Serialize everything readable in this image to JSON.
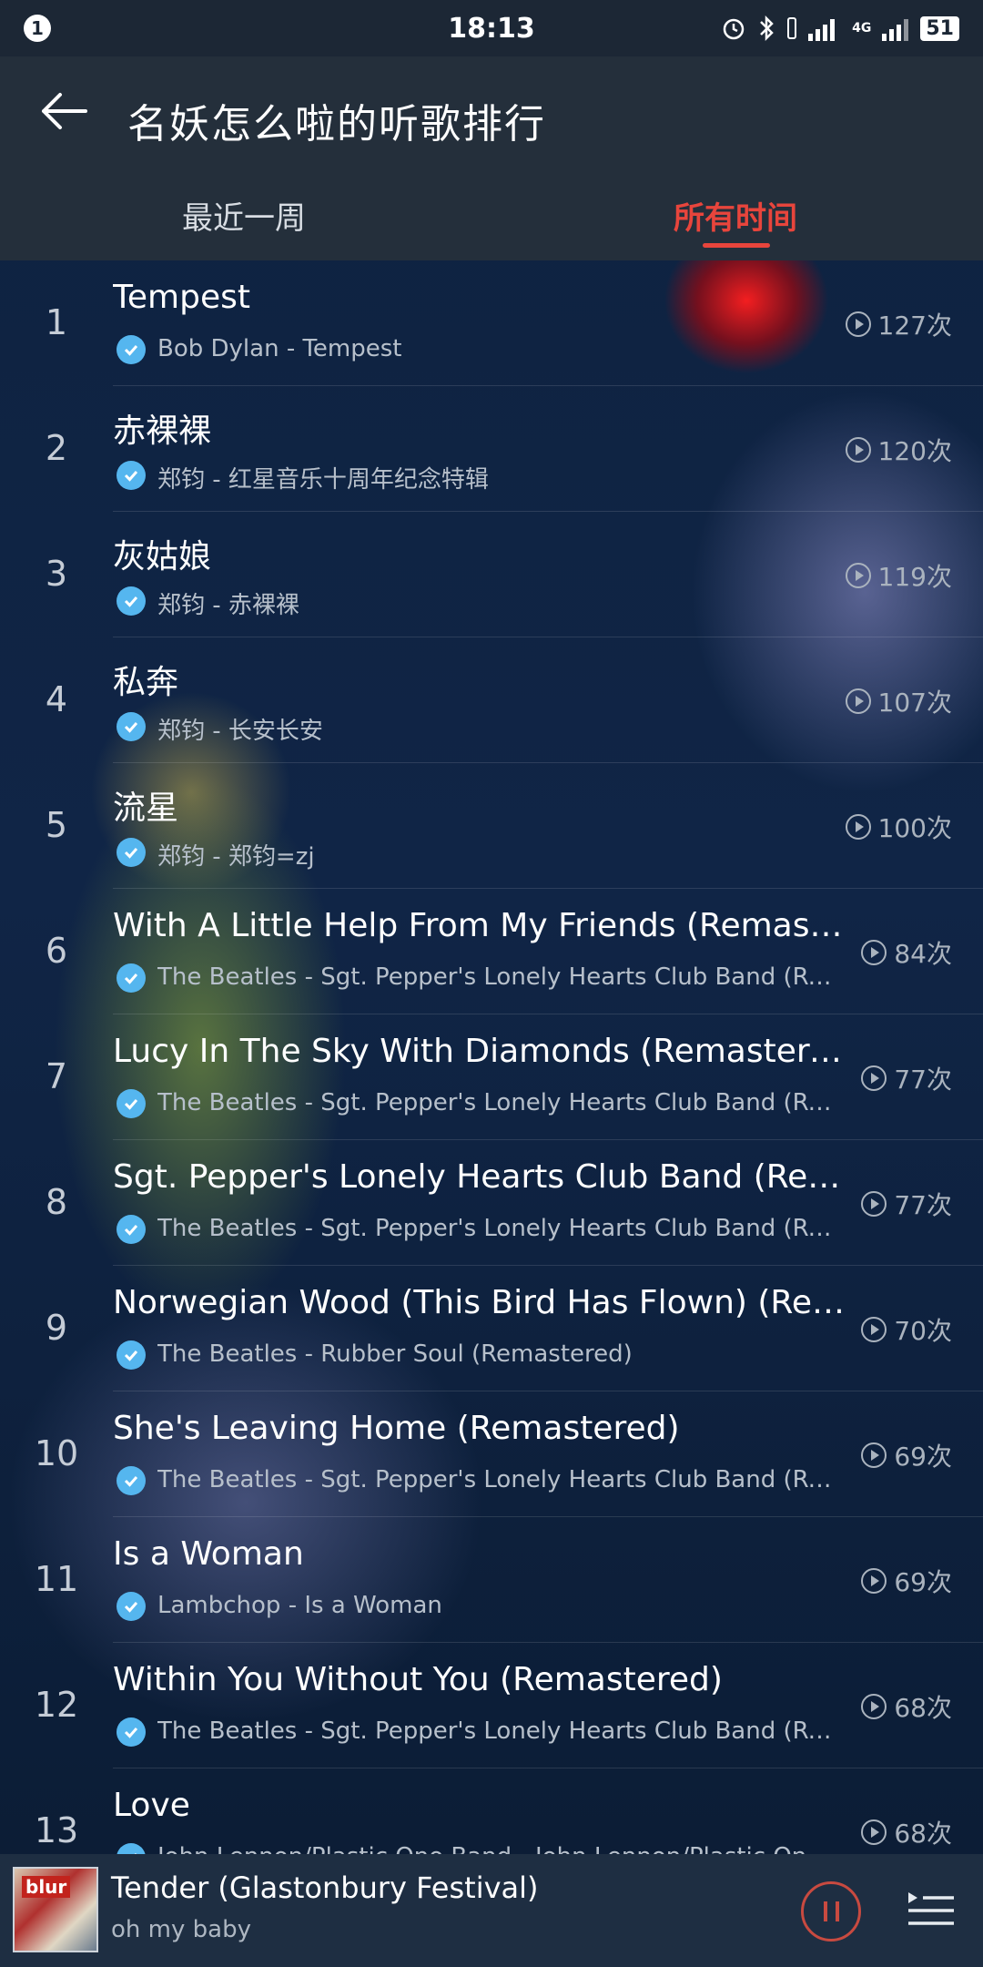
{
  "status": {
    "notification_count": "1",
    "time": "18:13",
    "net_label": "4G",
    "battery": "51"
  },
  "header": {
    "title": "名妖怎么啦的听歌排行",
    "tabs": [
      {
        "label": "最近一周"
      },
      {
        "label": "所有时间"
      }
    ]
  },
  "songs": [
    {
      "rank": "1",
      "title": "Tempest",
      "sub": "Bob Dylan - Tempest",
      "count": "127次"
    },
    {
      "rank": "2",
      "title": "赤裸裸",
      "sub": "郑钧 - 红星音乐十周年纪念特辑",
      "count": "120次"
    },
    {
      "rank": "3",
      "title": "灰姑娘",
      "sub": "郑钧 - 赤裸裸",
      "count": "119次"
    },
    {
      "rank": "4",
      "title": "私奔",
      "sub": "郑钧 - 长安长安",
      "count": "107次"
    },
    {
      "rank": "5",
      "title": "流星",
      "sub": "郑钧 - 郑钧=zj",
      "count": "100次"
    },
    {
      "rank": "6",
      "title": "With A Little Help From My Friends (Remastered)",
      "sub": "The Beatles - Sgt. Pepper's Lonely Hearts Club Band (Rem...",
      "count": "84次"
    },
    {
      "rank": "7",
      "title": "Lucy In The Sky With Diamonds (Remastered)",
      "sub": "The Beatles - Sgt. Pepper's Lonely Hearts Club Band (Rem...",
      "count": "77次"
    },
    {
      "rank": "8",
      "title": "Sgt. Pepper's Lonely Hearts Club Band (Rema...",
      "sub": "The Beatles - Sgt. Pepper's Lonely Hearts Club Band (Rem...",
      "count": "77次"
    },
    {
      "rank": "9",
      "title": "Norwegian Wood (This Bird Has Flown) (Rema...",
      "sub": "The Beatles - Rubber Soul (Remastered)",
      "count": "70次"
    },
    {
      "rank": "10",
      "title": "She's Leaving Home (Remastered)",
      "sub": "The Beatles - Sgt. Pepper's Lonely Hearts Club Band (Rem...",
      "count": "69次"
    },
    {
      "rank": "11",
      "title": "Is a Woman",
      "sub": "Lambchop - Is a Woman",
      "count": "69次"
    },
    {
      "rank": "12",
      "title": "Within You Without You (Remastered)",
      "sub": "The Beatles - Sgt. Pepper's Lonely Hearts Club Band (Rem...",
      "count": "68次"
    },
    {
      "rank": "13",
      "title": "Love",
      "sub": "John Lennon/Plastic Ono Band - John Lennon/Plastic Ono...",
      "count": "68次"
    }
  ],
  "player": {
    "album_logo": "blur",
    "title": "Tender (Glastonbury Festival)",
    "subtitle": "oh my baby"
  },
  "colors": {
    "accent": "#e8453c",
    "verified": "#55b6ef",
    "header_bg": "#242f3b",
    "player_bg": "#1e2e42"
  }
}
